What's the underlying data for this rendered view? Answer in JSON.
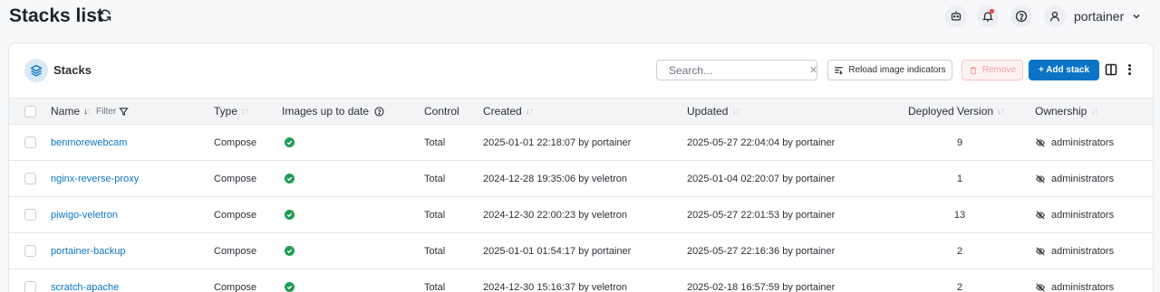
{
  "header": {
    "title": "Stacks list",
    "user": "portainer"
  },
  "card": {
    "title": "Stacks",
    "search_placeholder": "Search...",
    "clear_label": "✕",
    "reload_label": "Reload image indicators",
    "remove_label": "Remove",
    "add_label": "+ Add stack"
  },
  "table": {
    "columns": {
      "name": "Name",
      "filter": "Filter",
      "type": "Type",
      "images": "Images up to date",
      "control": "Control",
      "created": "Created",
      "updated": "Updated",
      "version": "Deployed Version",
      "ownership": "Ownership"
    },
    "rows": [
      {
        "name": "benmorewebcam",
        "type": "Compose",
        "control": "Total",
        "created": "2025-01-01 22:18:07 by portainer",
        "updated": "2025-05-27 22:04:04 by portainer",
        "version": "9",
        "ownership": "administrators"
      },
      {
        "name": "nginx-reverse-proxy",
        "type": "Compose",
        "control": "Total",
        "created": "2024-12-28 19:35:06 by veletron",
        "updated": "2025-01-04 02:20:07 by portainer",
        "version": "1",
        "ownership": "administrators"
      },
      {
        "name": "piwigo-veletron",
        "type": "Compose",
        "control": "Total",
        "created": "2024-12-30 22:00:23 by veletron",
        "updated": "2025-05-27 22:01:53 by portainer",
        "version": "13",
        "ownership": "administrators"
      },
      {
        "name": "portainer-backup",
        "type": "Compose",
        "control": "Total",
        "created": "2025-01-01 01:54:17 by portainer",
        "updated": "2025-05-27 22:16:36 by portainer",
        "version": "2",
        "ownership": "administrators"
      },
      {
        "name": "scratch-apache",
        "type": "Compose",
        "control": "Total",
        "created": "2024-12-30 15:16:37 by veletron",
        "updated": "2025-02-18 16:57:59 by portainer",
        "version": "2",
        "ownership": "administrators"
      }
    ]
  },
  "colors": {
    "accent": "#0b74c6",
    "ok": "#1f9d55",
    "danger_soft": "#f0a0a0"
  },
  "icons": {
    "refresh": "refresh-icon",
    "bot": "bot-icon",
    "bell": "bell-icon",
    "help": "help-icon",
    "user": "user-icon",
    "chevron": "chevron-down-icon",
    "stacks": "stacks-icon",
    "search": "search-icon",
    "ok": "check-circle-icon",
    "ownership": "eye-off-icon"
  }
}
